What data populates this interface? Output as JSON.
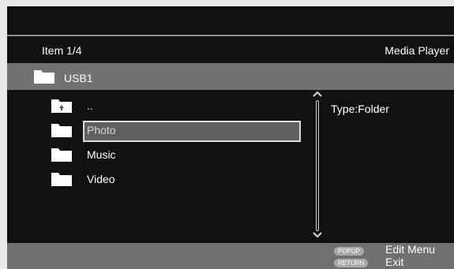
{
  "header": {
    "item_count": "Item 1/4",
    "title": "Media Player"
  },
  "path": {
    "label": "USB1"
  },
  "list": {
    "items": [
      {
        "label": "..",
        "icon": "folder-up-icon"
      },
      {
        "label": "Photo",
        "icon": "folder-icon",
        "selected": true
      },
      {
        "label": "Music",
        "icon": "folder-icon"
      },
      {
        "label": "Video",
        "icon": "folder-icon"
      }
    ]
  },
  "info": {
    "type_text": "Type:Folder"
  },
  "footer": {
    "popup_button": "POPUP",
    "popup_label": "Edit Menu",
    "return_button": "RETURN",
    "return_label": "Exit"
  },
  "colors": {
    "background": "#111111",
    "path_bar": "#727272",
    "selection": "#606060",
    "footer_bar": "#707070"
  }
}
